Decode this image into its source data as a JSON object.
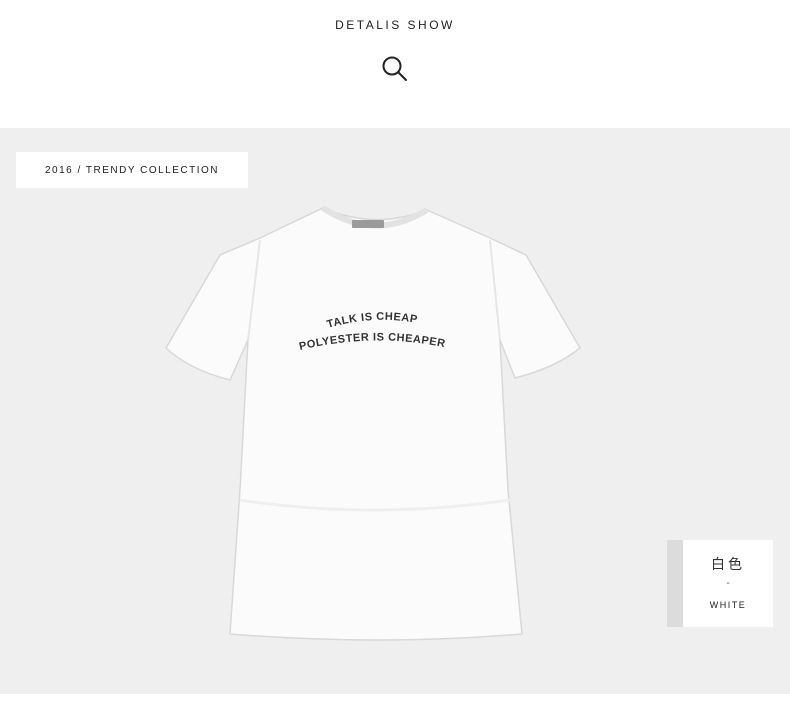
{
  "header": {
    "title": "DETALIS SHOW",
    "icon": "search-icon"
  },
  "product": {
    "collection_tag": "2016 / TRENDY COLLECTION",
    "shirt_print": {
      "line1": "TALK IS CHEAP",
      "line2": "POLYESTER IS CHEAPER"
    },
    "color": {
      "name_cn": "白色",
      "separator": "-",
      "name_en": "WHITE",
      "swatch_hex": "#dcdcdc"
    }
  },
  "colors": {
    "panel_background": "#efefef",
    "shirt": "#fbfbfb"
  }
}
